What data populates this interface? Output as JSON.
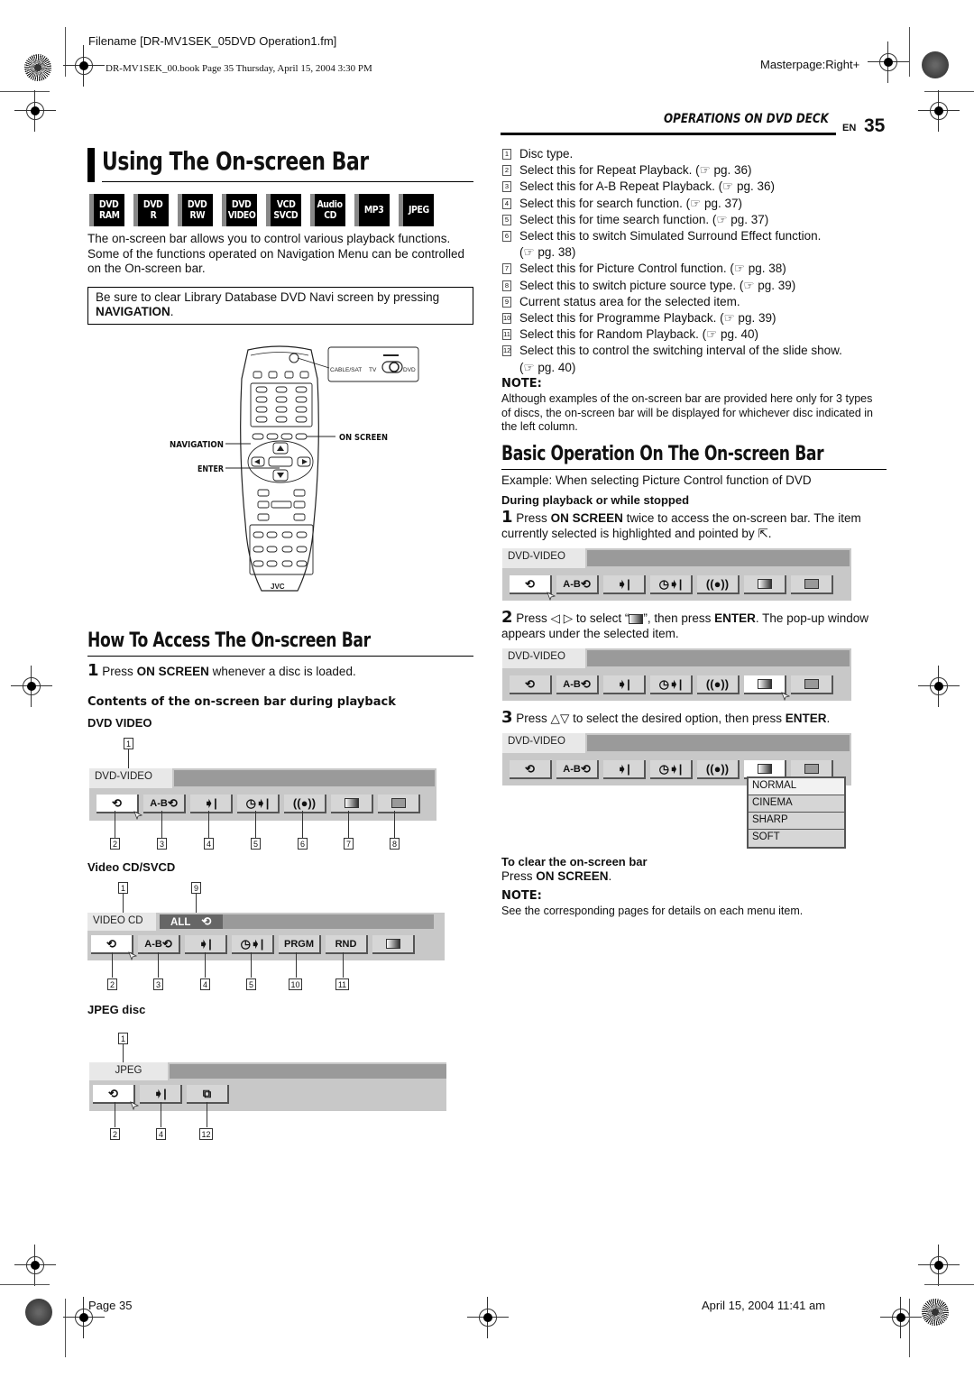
{
  "print_header": {
    "filename": "Filename [DR-MV1SEK_05DVD Operation1.fm]",
    "book_line": "DR-MV1SEK_00.book  Page 35  Thursday, April 15, 2004  3:30 PM",
    "masterpage": "Masterpage:Right+"
  },
  "section": {
    "header": "OPERATIONS ON DVD DECK",
    "lang": "EN",
    "page_number": "35"
  },
  "title": "Using The On-screen Bar",
  "disc_badges": [
    {
      "line1": "DVD",
      "line2": "RAM"
    },
    {
      "line1": "DVD",
      "line2": "R"
    },
    {
      "line1": "DVD",
      "line2": "RW"
    },
    {
      "line1": "DVD",
      "line2": "VIDEO"
    },
    {
      "line1": "VCD",
      "line2": "SVCD"
    },
    {
      "line1": "Audio",
      "line2": "CD"
    },
    {
      "line1": "MP3",
      "line2": ""
    },
    {
      "line1": "JPEG",
      "line2": ""
    }
  ],
  "intro": "The on-screen bar allows you to control various playback functions. Some of the functions operated on Navigation Menu can be controlled on the On-screen bar.",
  "notebox": {
    "text": "Be sure to clear Library Database DVD Navi screen by pressing",
    "bold": "NAVIGATION",
    "end": "."
  },
  "remote": {
    "labels": {
      "navigation": "NAVIGATION",
      "enter": "ENTER",
      "on_screen": "ON SCREEN",
      "cable_sat": "CABLE/SAT",
      "tv": "TV",
      "dvd": "DVD",
      "brand": "JVC"
    }
  },
  "how_to_access": {
    "heading": "How To Access The On-screen Bar",
    "step1": {
      "num": "1",
      "pre": "Press",
      "bold": "ON SCREEN",
      "post": "whenever a disc is loaded."
    },
    "contents_heading": "Contents of the on-screen bar during playback",
    "dvd_video": {
      "label": "DVD VIDEO",
      "bar_label": "DVD-VIDEO",
      "buttons": [
        "repeat",
        "A-B repeat",
        "search",
        "time search",
        "surround",
        "picture control",
        "picture source"
      ],
      "callouts_top": [
        "1"
      ],
      "callouts_bottom": [
        "2",
        "3",
        "4",
        "5",
        "6",
        "7",
        "8"
      ]
    },
    "vcd": {
      "label": "Video CD/SVCD",
      "bar_label": "VIDEO CD",
      "status": "ALL",
      "buttons": [
        "repeat",
        "A-B repeat",
        "search",
        "time search",
        "PRGM",
        "RND",
        "picture control"
      ],
      "callouts_top": [
        "1",
        "9"
      ],
      "callouts_bottom": [
        "2",
        "3",
        "4",
        "5",
        "10",
        "11"
      ]
    },
    "jpeg": {
      "label": "JPEG disc",
      "bar_label": "JPEG",
      "buttons": [
        "repeat",
        "search",
        "slide show"
      ],
      "callouts_top": [
        "1"
      ],
      "callouts_bottom": [
        "2",
        "4",
        "12"
      ]
    },
    "button_text": {
      "ab": "A-B",
      "prgm": "PRGM",
      "rnd": "RND"
    }
  },
  "numbered_list": [
    {
      "n": "1",
      "text": "Disc type."
    },
    {
      "n": "2",
      "text": "Select this for Repeat Playback. (☞ pg. 36)"
    },
    {
      "n": "3",
      "text": "Select this for A-B Repeat Playback. (☞ pg. 36)"
    },
    {
      "n": "4",
      "text": "Select this for search function. (☞ pg. 37)"
    },
    {
      "n": "5",
      "text": "Select this for time search function. (☞ pg. 37)"
    },
    {
      "n": "6",
      "text": "Select this to switch Simulated Surround Effect function.",
      "cont": "(☞ pg. 38)"
    },
    {
      "n": "7",
      "text": "Select this for Picture Control function. (☞ pg. 38)"
    },
    {
      "n": "8",
      "text": "Select this to switch picture source type. (☞ pg. 39)"
    },
    {
      "n": "9",
      "text": "Current status area for the selected item."
    },
    {
      "n": "10",
      "text": "Select this for Programme Playback. (☞ pg. 39)"
    },
    {
      "n": "11",
      "text": "Select this for Random Playback. (☞ pg. 40)"
    },
    {
      "n": "12",
      "text": "Select this to control the switching interval of the slide show.",
      "cont": "(☞ pg. 40)"
    }
  ],
  "note1": {
    "label": "NOTE:",
    "text": "Although examples of the on-screen bar are provided here only for 3 types of discs, the on-screen bar will be displayed for whichever disc indicated in the left column."
  },
  "basic_operation": {
    "heading": "Basic Operation On The On-screen Bar",
    "example": "Example: When selecting Picture Control function of DVD",
    "subheading": "During playback or while stopped",
    "step1": {
      "num": "1",
      "pre": "Press",
      "bold": "ON SCREEN",
      "post": "twice to access the on-screen bar. The item currently selected is highlighted and pointed by"
    },
    "step2": {
      "num": "2",
      "pre": "Press ◁ ▷ to select “",
      "mid": "”, then press",
      "bold": "ENTER",
      "post": ". The pop-up window appears under the selected item."
    },
    "step3": {
      "num": "3",
      "pre": "Press △▽ to select the desired option, then press",
      "bold": "ENTER",
      "post": "."
    },
    "bar_label": "DVD-VIDEO",
    "popup_options": [
      "NORMAL",
      "CINEMA",
      "SHARP",
      "SOFT"
    ],
    "clear_heading": "To clear the on-screen bar",
    "clear_pre": "Press",
    "clear_bold": "ON SCREEN",
    "clear_post": "."
  },
  "note2": {
    "label": "NOTE:",
    "text": "See the corresponding pages for details on each menu item."
  },
  "footer": {
    "page": "Page 35",
    "date": "April 15, 2004 11:41 am"
  }
}
